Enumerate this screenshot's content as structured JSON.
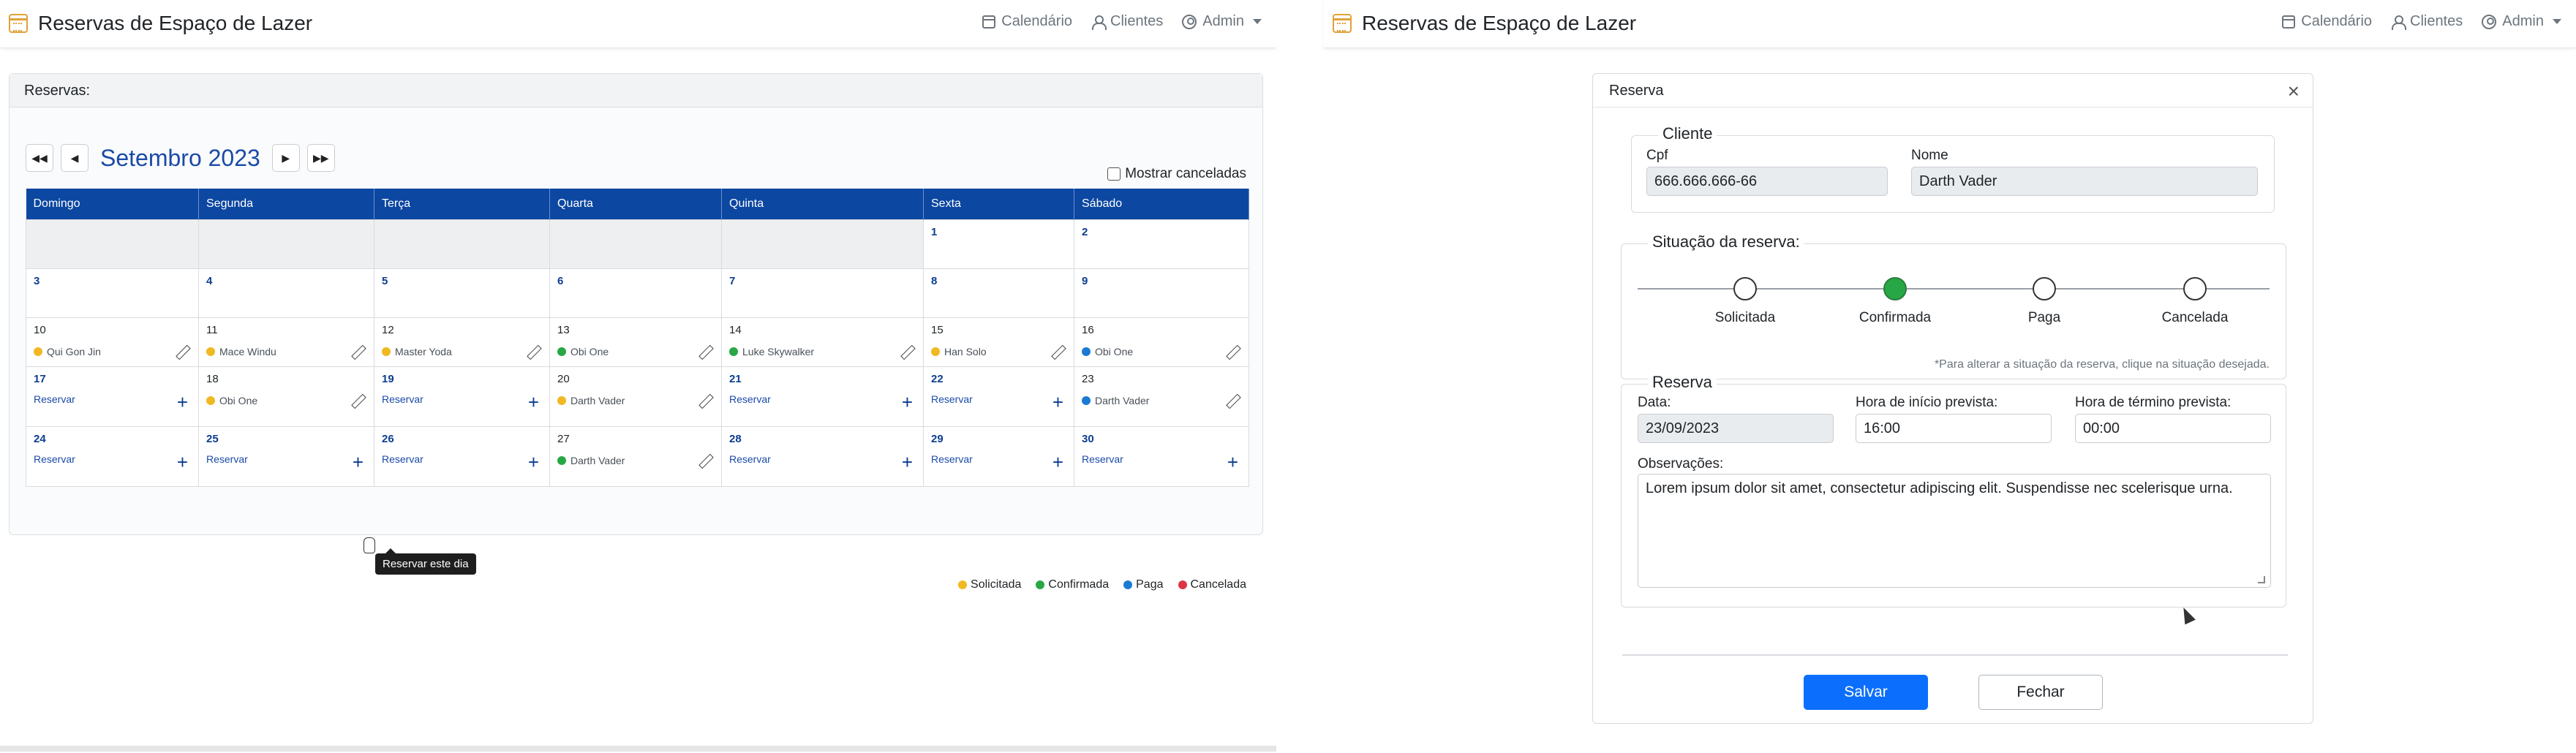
{
  "app": {
    "title": "Reservas de Espaço de Lazer",
    "nav": {
      "calendar": "Calendário",
      "clients": "Clientes",
      "admin": "Admin"
    }
  },
  "calendar_view": {
    "card_title": "Reservas:",
    "month": "Setembro 2023",
    "show_cancelled": "Mostrar canceladas",
    "weekdays": [
      "Domingo",
      "Segunda",
      "Terça",
      "Quarta",
      "Quinta",
      "Sexta",
      "Sábado"
    ],
    "cells": {
      "d1": "1",
      "d2": "2",
      "d3": "3",
      "d4": "4",
      "d5": "5",
      "d6": "6",
      "d7": "7",
      "d8": "8",
      "d9": "9",
      "d10": "10",
      "d11": "11",
      "d12": "12",
      "d13": "13",
      "d14": "14",
      "d15": "15",
      "d16": "16",
      "d17": "17",
      "d18": "18",
      "d19": "19",
      "d20": "20",
      "d21": "21",
      "d22": "22",
      "d23": "23",
      "d24": "24",
      "d25": "25",
      "d26": "26",
      "d27": "27",
      "d28": "28",
      "d29": "29",
      "d30": "30"
    },
    "events": {
      "e10": "Qui Gon Jin",
      "e11": "Mace Windu",
      "e12": "Master Yoda",
      "e13": "Obi One",
      "e14": "Luke Skywalker",
      "e15": "Han Solo",
      "e16": "Obi One",
      "e18": "Obi One",
      "e20": "Darth Vader",
      "e23": "Darth Vader",
      "e27": "Darth Vader"
    },
    "reserve_label": "Reservar",
    "tooltip": "Reservar este dia",
    "legend": {
      "requested": "Solicitada",
      "confirmed": "Confirmada",
      "paid": "Paga",
      "cancelled": "Cancelada"
    },
    "colors": {
      "requested": "#f0b921",
      "confirmed": "#28a745",
      "paid": "#1b7ad4",
      "cancelled": "#dc3545",
      "header": "#0c47a1"
    }
  },
  "modal": {
    "title": "Reserva",
    "client_section": "Cliente",
    "cpf_label": "Cpf",
    "cpf_value": "666.666.666-66",
    "name_label": "Nome",
    "name_value": "Darth Vader",
    "status_section": "Situação da reserva:",
    "status_steps": [
      "Solicitada",
      "Confirmada",
      "Paga",
      "Cancelada"
    ],
    "status_hint": "*Para alterar a situação da reserva, clique na situação desejada.",
    "reserve_section": "Reserva",
    "date_label": "Data:",
    "date_value": "23/09/2023",
    "start_label": "Hora de início prevista:",
    "start_value": "16:00",
    "end_label": "Hora de término prevista:",
    "end_value": "00:00",
    "notes_label": "Observações:",
    "notes_value": "Lorem ipsum dolor sit amet, consectetur adipiscing elit. Suspendisse nec scelerisque urna.",
    "save": "Salvar",
    "close": "Fechar"
  }
}
